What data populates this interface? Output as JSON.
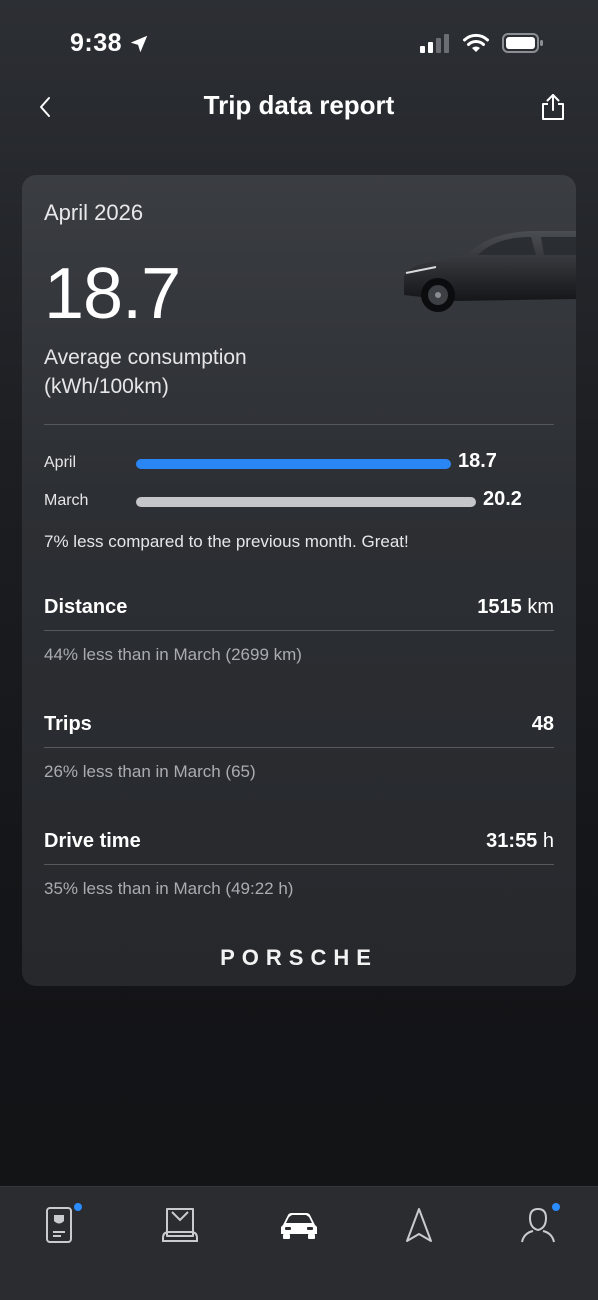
{
  "status": {
    "time": "9:38"
  },
  "header": {
    "title": "Trip data report"
  },
  "summary": {
    "period": "April 2026",
    "value": "18.7",
    "label": "Average consumption (kWh/100km)"
  },
  "comparison": {
    "rows": [
      {
        "label": "April",
        "value": "18.7",
        "fraction": 0.925,
        "color": "#2a86f5"
      },
      {
        "label": "March",
        "value": "20.2",
        "fraction": 1.0,
        "color": "#c4c6c9"
      }
    ],
    "note": "7% less compared to the previous month. Great!"
  },
  "stats": [
    {
      "title": "Distance",
      "value": "1515",
      "unit": "km",
      "note": "44% less than in March (2699 km)"
    },
    {
      "title": "Trips",
      "value": "48",
      "unit": "",
      "note": "26% less than in March (65)"
    },
    {
      "title": "Drive time",
      "value": "31:55",
      "unit": "h",
      "note": "35% less than in March (49:22 h)"
    }
  ],
  "brand": "PORSCHE",
  "tabs": [
    {
      "icon": "phone-key-icon",
      "badge": true
    },
    {
      "icon": "car-service-icon",
      "badge": false
    },
    {
      "icon": "car-front-icon",
      "badge": false,
      "active": true
    },
    {
      "icon": "navigation-icon",
      "badge": false
    },
    {
      "icon": "profile-icon",
      "badge": true
    }
  ]
}
